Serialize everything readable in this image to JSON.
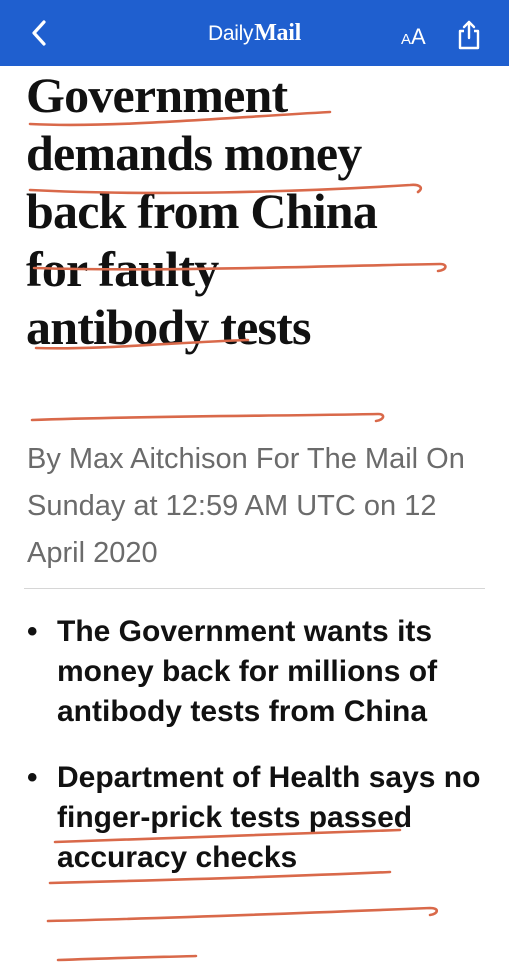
{
  "topbar": {
    "brand_part1": "Daily",
    "brand_part2": "Mail",
    "text_size_small": "A",
    "text_size_large": "A",
    "bar_color": "#1f5fcf"
  },
  "icons": {
    "back": "chevron-left-icon",
    "share": "share-icon"
  },
  "article": {
    "headline_lines": [
      "Government",
      "demands money",
      "back from China",
      "for faulty",
      "antibody tests"
    ],
    "byline": "By Max Aitchison For The Mail On Sunday at 12:59 AM UTC on 12 April 2020",
    "bullets": [
      {
        "marker": "•",
        "text": "The Government wants its money back for millions of antibody tests from China"
      },
      {
        "marker": "•",
        "text": "Department of Health says no finger-prick tests passed accuracy checks"
      }
    ]
  },
  "annotation": {
    "underline_color": "#d9694a"
  }
}
